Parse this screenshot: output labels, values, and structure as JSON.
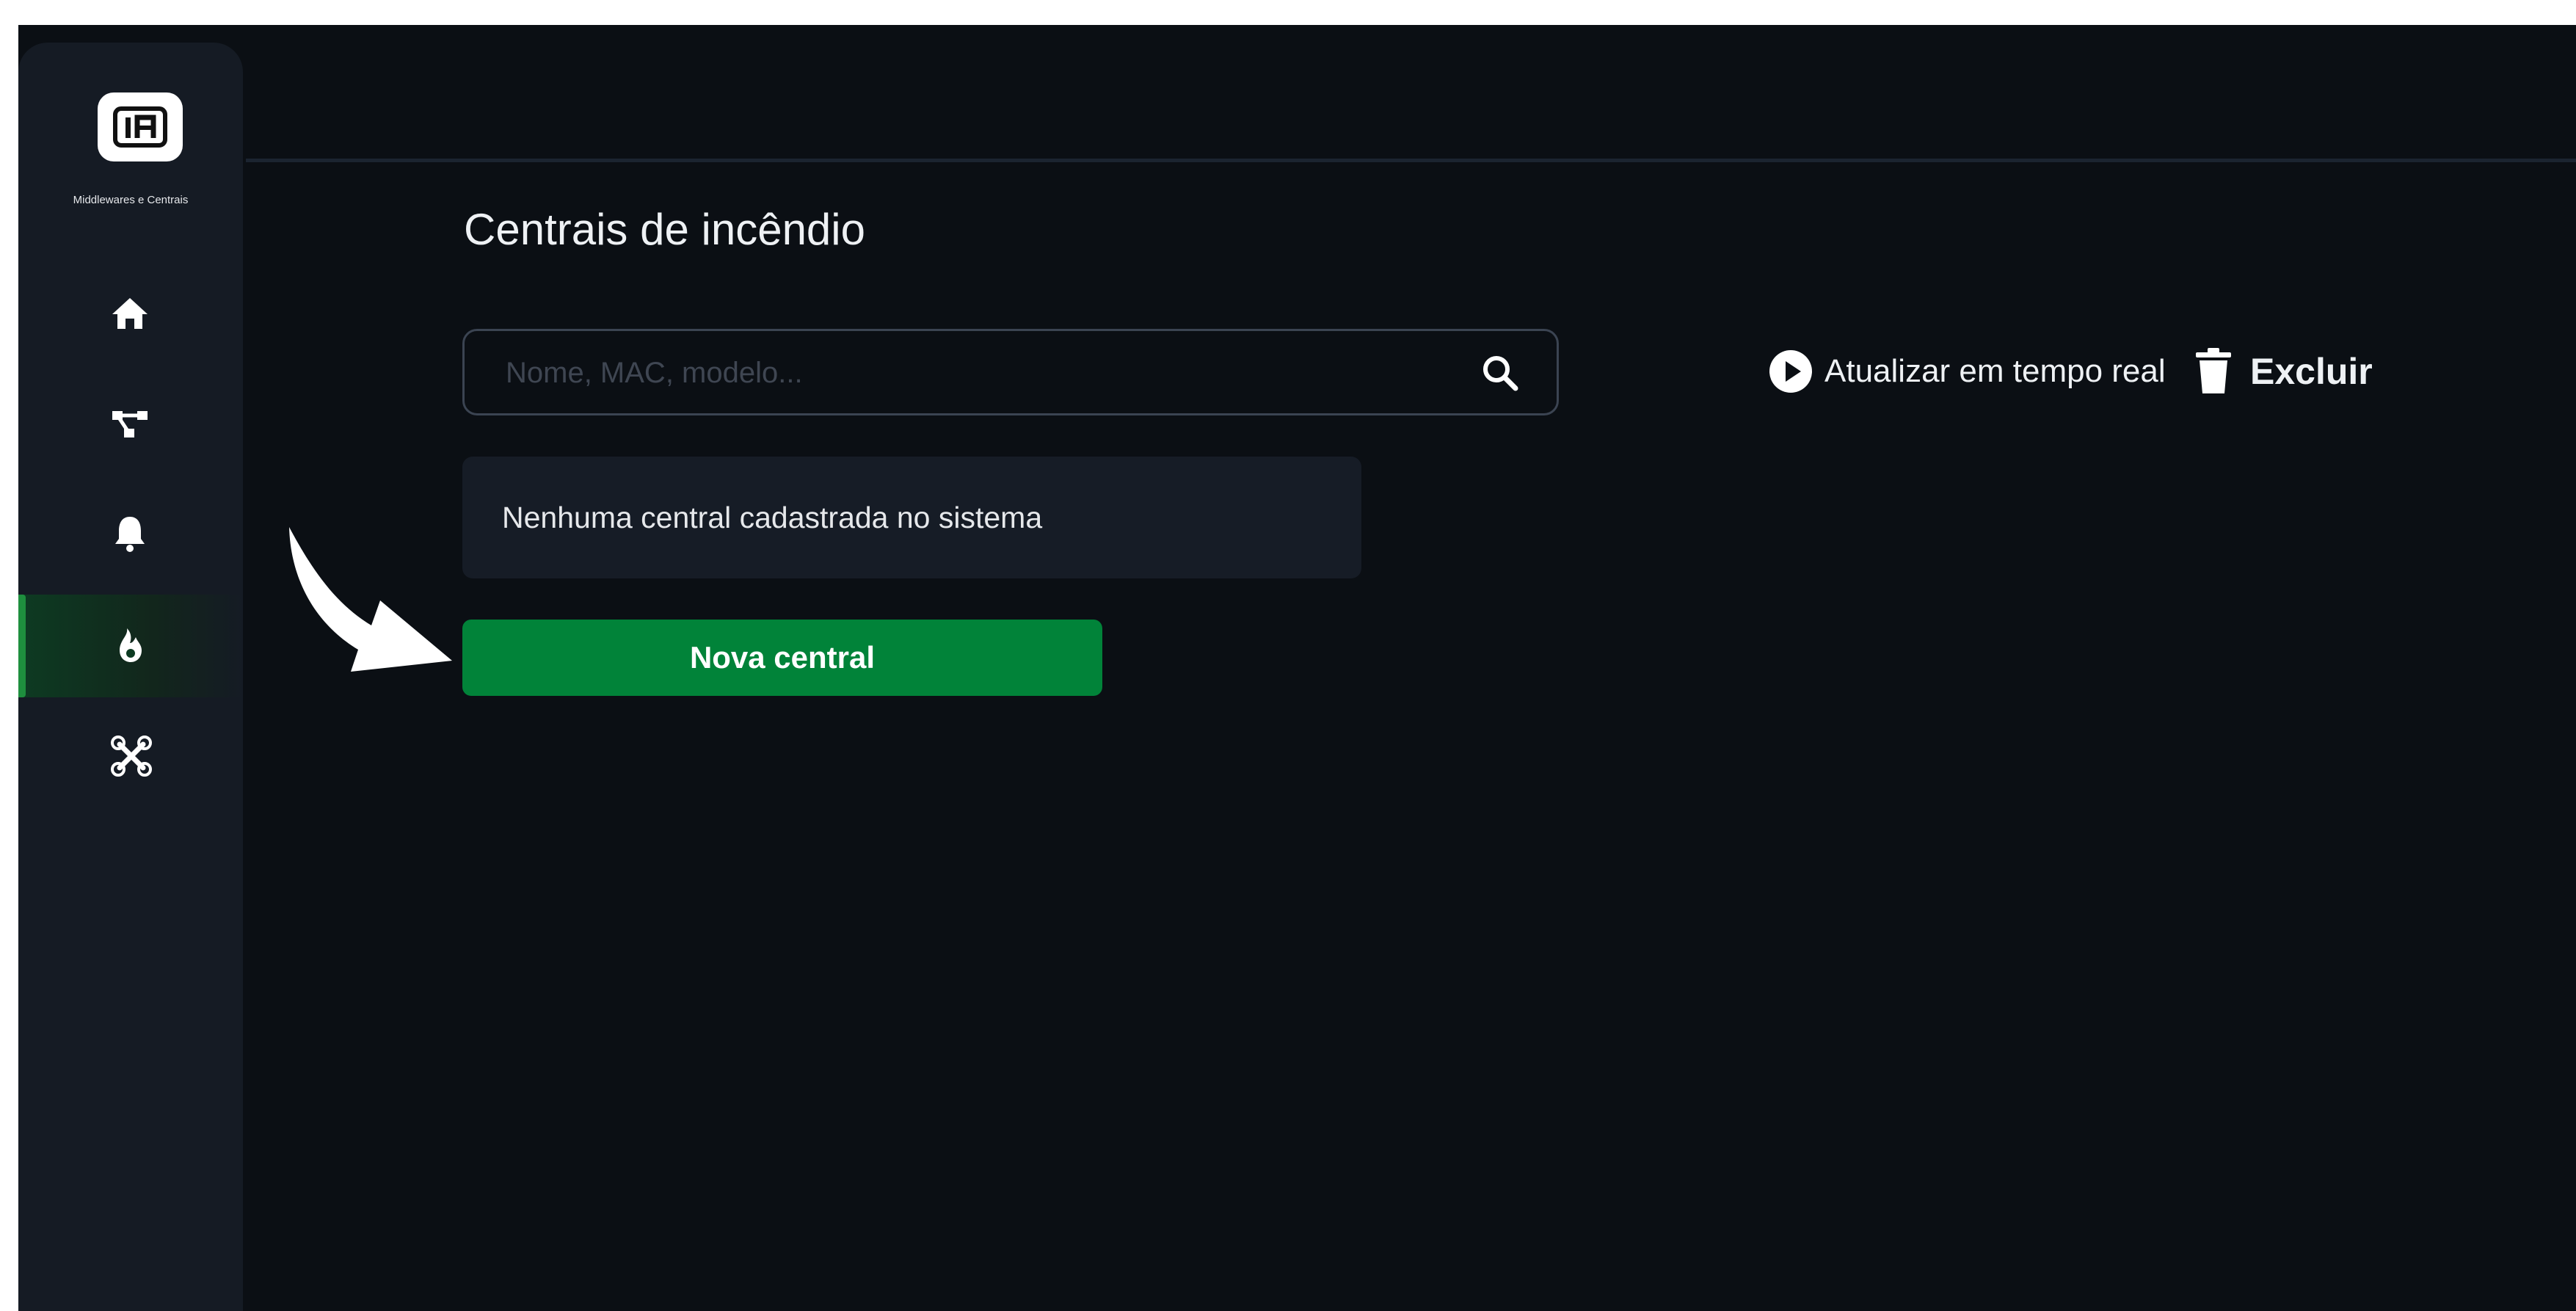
{
  "sidebar": {
    "brand": "Middlewares e Centrais",
    "items": [
      {
        "name": "home",
        "icon": "home-icon"
      },
      {
        "name": "network",
        "icon": "network-icon"
      },
      {
        "name": "alarms",
        "icon": "bell-icon"
      },
      {
        "name": "fire-panels",
        "icon": "flame-icon",
        "active": true
      },
      {
        "name": "devices",
        "icon": "drone-icon"
      }
    ]
  },
  "main": {
    "title": "Centrais de incêndio",
    "search": {
      "placeholder": "Nome, MAC, modelo...",
      "value": ""
    },
    "actions": {
      "live_update": "Atualizar em tempo real",
      "delete": "Excluir"
    },
    "empty_message": "Nenhuma central cadastrada no sistema",
    "new_button": "Nova central"
  },
  "colors": {
    "background": "#0b0f14",
    "sidebar": "#151b24",
    "accent_green": "#018339",
    "text": "#eef1f4"
  }
}
